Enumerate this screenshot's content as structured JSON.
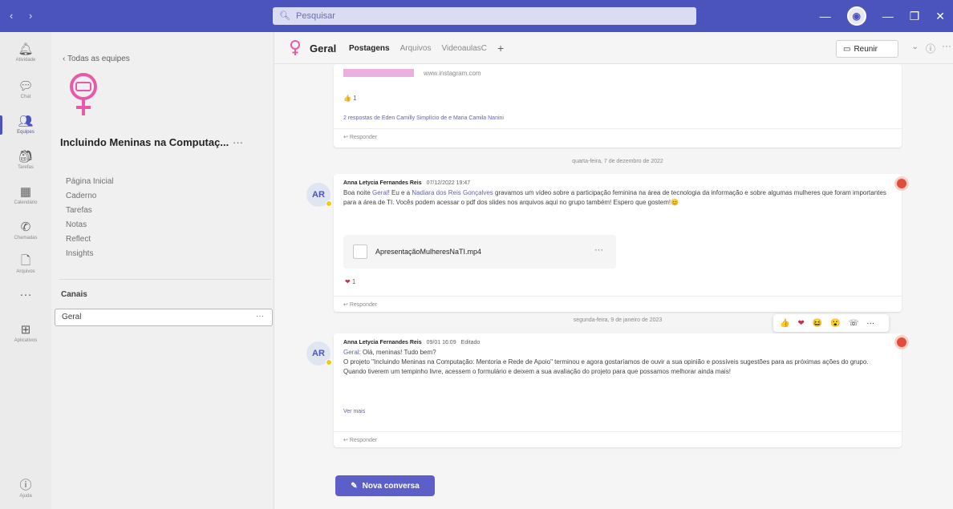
{
  "titlebar": {
    "search_placeholder": "Pesquisar",
    "window_controls": [
      "—",
      "—",
      "❐",
      "✕"
    ]
  },
  "rail": {
    "items": [
      {
        "label": "Atividade",
        "icon": "bell-icon"
      },
      {
        "label": "Chat",
        "icon": "chat-icon"
      },
      {
        "label": "Equipes",
        "icon": "teams-icon",
        "active": true
      },
      {
        "label": "Tarefas",
        "icon": "tasks-icon"
      },
      {
        "label": "Calendário",
        "icon": "calendar-icon"
      },
      {
        "label": "Chamadas",
        "icon": "phone-icon"
      },
      {
        "label": "Arquivos",
        "icon": "file-icon"
      },
      {
        "label": "",
        "icon": "more-icon"
      },
      {
        "label": "Aplicativos",
        "icon": "apps-icon"
      },
      {
        "label": "Ajuda",
        "icon": "help-icon"
      }
    ]
  },
  "team": {
    "back_label": "Todas as equipes",
    "name": "Incluindo Meninas na Computaç...",
    "more": "···",
    "nav": [
      "Página Inicial",
      "Caderno",
      "Tarefas",
      "Notas",
      "Reflect",
      "Insights"
    ],
    "channels_heading": "Canais",
    "channels": [
      {
        "name": "Geral",
        "more": "···"
      }
    ]
  },
  "channel_header": {
    "title": "Geral",
    "tabs": [
      "Postagens",
      "Arquivos",
      "VideoaulasC"
    ],
    "add_tab": "+",
    "meet_label": "Reunir",
    "meet_chevron": "⌄",
    "info": "ⓘ",
    "more": "···"
  },
  "thread0": {
    "link_preview": "www.instagram.com",
    "reaction": "👍 1",
    "replies_summary": "2 respostas de Eden Camilly Simplício de e Maria Camila Nanini",
    "reply_label": "Responder"
  },
  "date1": "quarta-feira, 7 de dezembro de 2022",
  "msg1": {
    "avatar": "AR",
    "author": "Anna Letycia Fernandes Reis",
    "timestamp": "07/12/2022 19:47",
    "text_before": "Boa noite ",
    "mention1": "Geral",
    "text_mid1": "! Eu e a ",
    "mention2": "Nadiara dos Reis Gonçalves",
    "text_rest": " gravamos um vídeo sobre a participação feminina na área de tecnologia da informação e sobre algumas mulheres que foram importantes para a área de TI. Vocês podem acessar o pdf dos slides nos arquivos aqui no grupo também! Espero que gostem!😊",
    "file_name": "ApresentaçãoMulheresNaTI.mp4",
    "file_more": "···",
    "reaction": "❤ 1",
    "reply_label": "Responder"
  },
  "date2": "segunda-feira, 9 de janeiro de 2023",
  "hover_reactions": [
    "👍",
    "❤",
    "😆",
    "😮",
    "☏",
    "···"
  ],
  "msg2": {
    "avatar": "AR",
    "author": "Anna Letycia Fernandes Reis",
    "timestamp": "09/01 16:09",
    "edited": "Editado",
    "mention": "Geral",
    "greeting": ": Olá, meninas! Tudo bem?",
    "line2": "O projeto \"Incluindo Meninas na Computação: Mentoria e Rede de Apoio\" terminou e agora gostaríamos de ouvir a sua opinião e possíveis sugestões para as próximas ações do grupo.",
    "line3": "Quando tiverem um tempinho livre, acessem o formulário e deixem a sua avaliação do projeto para que possamos melhorar ainda mais!",
    "see_more": "Ver mais",
    "reply_label": "Responder"
  },
  "new_conversation": "Nova conversa",
  "colors": {
    "brand": "#4b53bc",
    "button": "#5b5fc7",
    "team_logo": "#e85aa9",
    "mark": "#e04e3a"
  }
}
